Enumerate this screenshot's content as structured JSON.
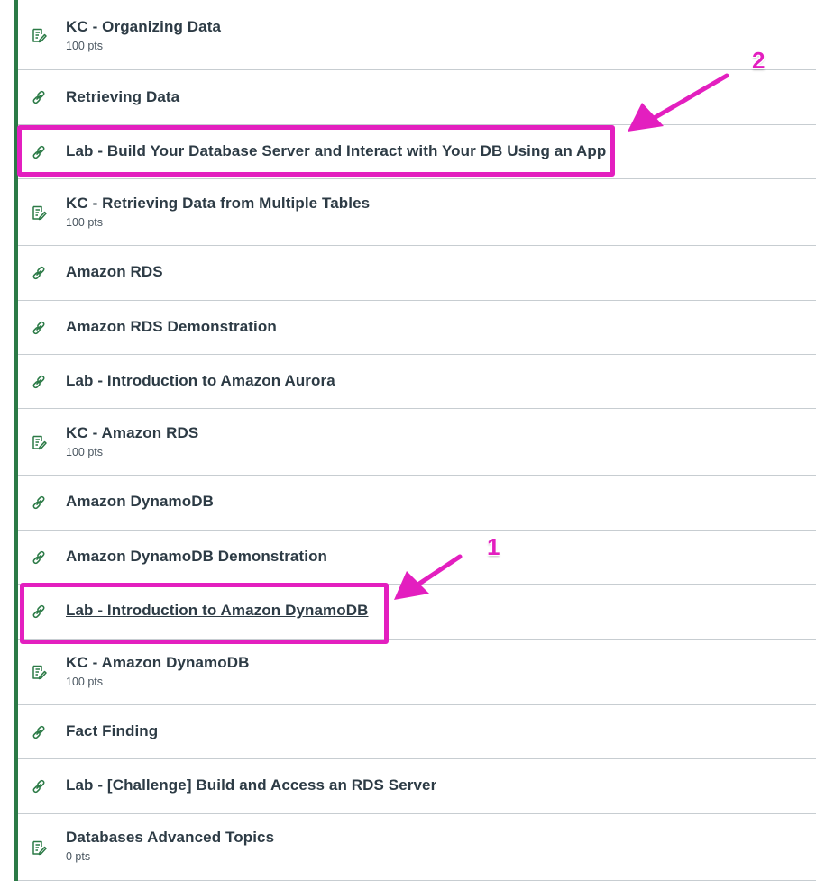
{
  "colors": {
    "module_bar": "#2b7a46",
    "annotation": "#e31fbf",
    "icon": "#2b7a46",
    "divider": "#c7cdd1"
  },
  "items": [
    {
      "type": "assignment",
      "icon": "assignment-icon",
      "title": "KC - Organizing Data",
      "meta": "100 pts"
    },
    {
      "type": "external_tool",
      "icon": "link-icon",
      "title": "Retrieving Data"
    },
    {
      "type": "external_tool",
      "icon": "link-icon",
      "title": "Lab - Build Your Database Server and Interact with Your DB Using an App"
    },
    {
      "type": "assignment",
      "icon": "assignment-icon",
      "title": "KC - Retrieving Data from Multiple Tables",
      "meta": "100 pts"
    },
    {
      "type": "external_tool",
      "icon": "link-icon",
      "title": "Amazon RDS"
    },
    {
      "type": "external_tool",
      "icon": "link-icon",
      "title": "Amazon RDS Demonstration"
    },
    {
      "type": "external_tool",
      "icon": "link-icon",
      "title": "Lab - Introduction to Amazon Aurora"
    },
    {
      "type": "assignment",
      "icon": "assignment-icon",
      "title": "KC - Amazon RDS",
      "meta": "100 pts"
    },
    {
      "type": "external_tool",
      "icon": "link-icon",
      "title": "Amazon DynamoDB"
    },
    {
      "type": "external_tool",
      "icon": "link-icon",
      "title": "Amazon DynamoDB Demonstration"
    },
    {
      "type": "external_tool",
      "icon": "link-icon",
      "title": "Lab - Introduction to Amazon DynamoDB"
    },
    {
      "type": "assignment",
      "icon": "assignment-icon",
      "title": "KC - Amazon DynamoDB",
      "meta": "100 pts"
    },
    {
      "type": "external_tool",
      "icon": "link-icon",
      "title": "Fact Finding"
    },
    {
      "type": "external_tool",
      "icon": "link-icon",
      "title": "Lab - [Challenge] Build and Access an RDS Server"
    },
    {
      "type": "assignment",
      "icon": "assignment-icon",
      "title": "Databases Advanced Topics",
      "meta": "0 pts"
    }
  ],
  "annotations": [
    {
      "label": "2"
    },
    {
      "label": "1"
    }
  ]
}
